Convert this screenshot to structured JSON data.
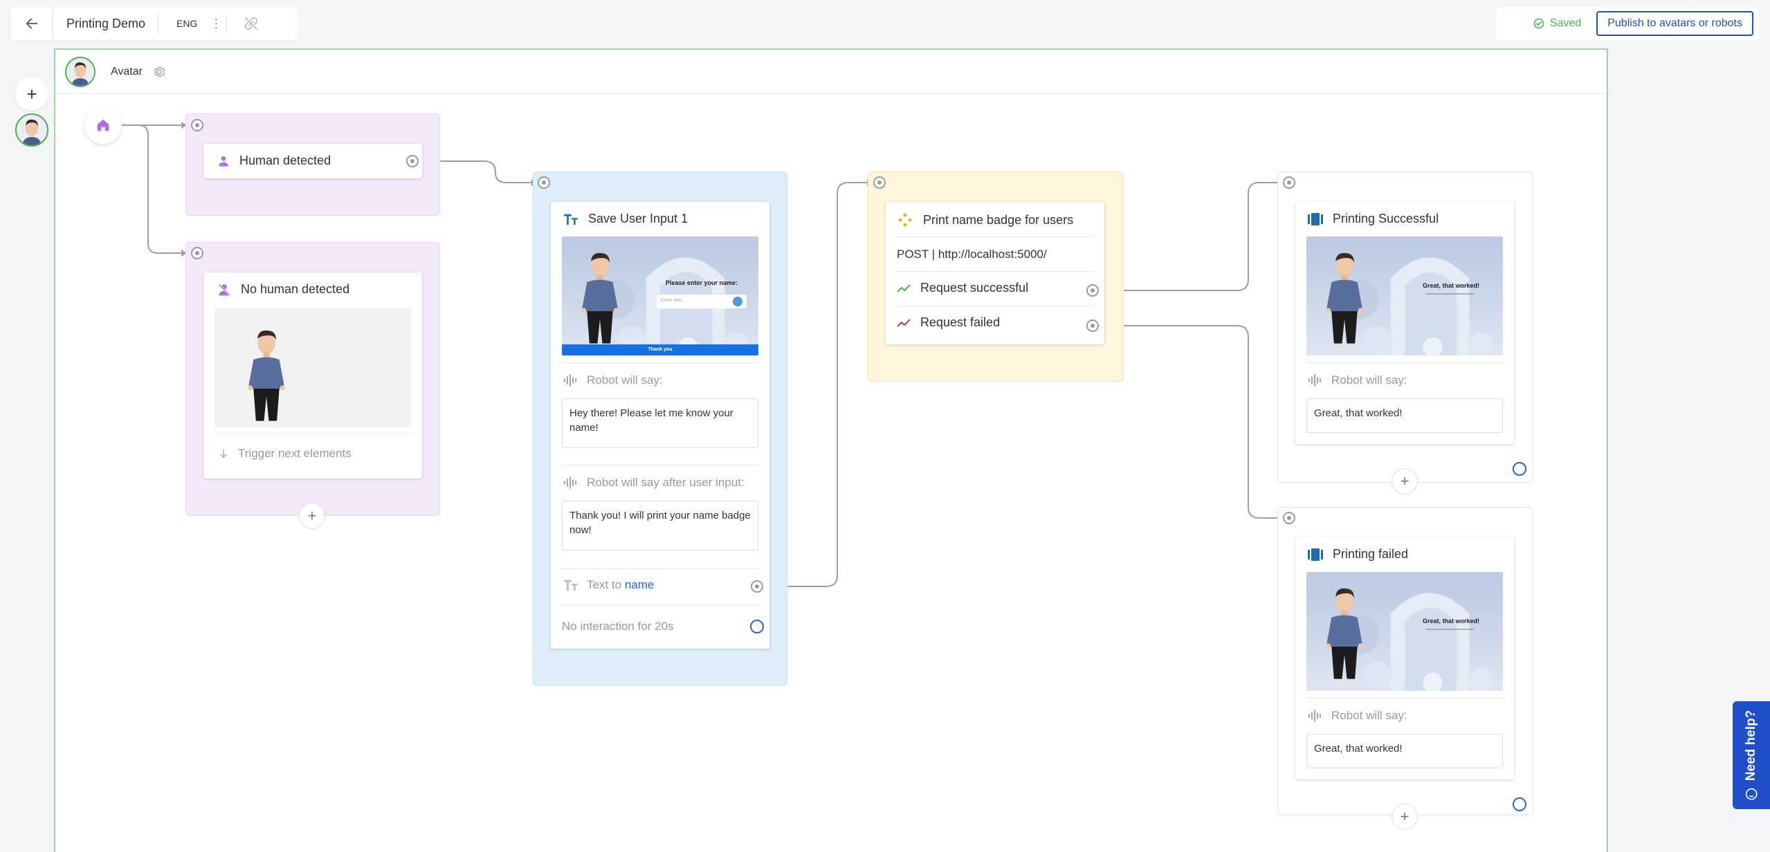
{
  "header": {
    "project_title": "Printing Demo",
    "language": "ENG",
    "saved_label": "Saved",
    "publish_label": "Publish to avatars or robots",
    "icons": [
      "arrow-left-icon",
      "kebab-icon",
      "unlink-icon",
      "check-circle-icon"
    ]
  },
  "canvas": {
    "title": "Avatar"
  },
  "nodes": {
    "human_detected": {
      "label": "Human detected"
    },
    "no_human_detected": {
      "label": "No human detected",
      "trigger_label": "Trigger next elements"
    },
    "save_user_input": {
      "title": "Save User Input 1",
      "robot_will_say_label": "Robot will say:",
      "robot_will_say_text": "Hey there! Please let me know your name!",
      "after_input_label": "Robot will say after user input:",
      "after_input_text": "Thank you! I will print your name badge now!",
      "text_to_label": "Text to",
      "text_to_var": "name",
      "no_interaction_label": "No interaction for 20s",
      "screen": {
        "prompt": "Please enter your name:",
        "input_placeholder": "Enter text...",
        "button": "Thank you"
      }
    },
    "print_badge": {
      "title": "Print name badge for users",
      "request": "POST | http://localhost:5000/",
      "success_label": "Request successful",
      "failed_label": "Request failed"
    },
    "printing_successful": {
      "title": "Printing Successful",
      "robot_will_say_label": "Robot will say:",
      "robot_will_say_text": "Great, that worked!",
      "screen_text": "Great, that worked!"
    },
    "printing_failed": {
      "title": "Printing failed",
      "robot_will_say_label": "Robot will say:",
      "robot_will_say_text": "Great, that worked!",
      "screen_text": "Great, that worked!"
    }
  },
  "help": {
    "label": "Need help?"
  },
  "colors": {
    "accent": "#1f4ec8",
    "success": "#4caf50",
    "purple": "#b26ce6",
    "teal": "#1d6fa5",
    "yellow": "#e2b21b"
  }
}
